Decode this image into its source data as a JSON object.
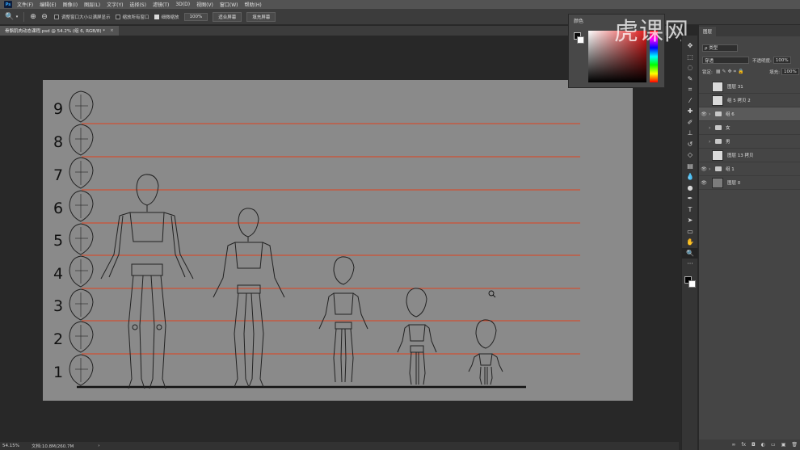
{
  "app": {
    "logo": "Ps"
  },
  "menu": [
    "文件(F)",
    "编辑(E)",
    "图像(I)",
    "图层(L)",
    "文字(Y)",
    "选择(S)",
    "滤镜(T)",
    "3D(D)",
    "视图(V)",
    "窗口(W)",
    "帮助(H)"
  ],
  "options": {
    "resize_windows": "调整窗口大小以满屏显示",
    "zoom_all": "缩放所有窗口",
    "scrubby_zoom": "细微缩放",
    "zoom_value": "100%",
    "fit_screen": "适合屏幕",
    "fill_screen": "填充屏幕"
  },
  "document": {
    "tab_title": "骨骼肌肉动态课程.psd @ 54.2% (组 6, RGB/8) *",
    "close": "×"
  },
  "status": {
    "zoom": "54.15%",
    "doc_size": "文档:10.8M/260.7M"
  },
  "color_panel": {
    "title": "颜色"
  },
  "watermark": "虎课网",
  "layers_panel": {
    "tab": "图层",
    "kind": "ρ 类型",
    "blend_mode": "穿透",
    "opacity_label": "不透明度:",
    "opacity": "100%",
    "lock_label": "锁定:",
    "fill_label": "填充:",
    "fill": "100%",
    "layers": [
      {
        "name": "图层 31",
        "type": "layer",
        "visible": false
      },
      {
        "name": "组 5 拷贝 2",
        "type": "layer",
        "visible": false
      },
      {
        "name": "组 6",
        "type": "group",
        "visible": true,
        "selected": true
      },
      {
        "name": "女",
        "type": "group",
        "visible": false
      },
      {
        "name": "男",
        "type": "group",
        "visible": false
      },
      {
        "name": "图层 13 拷贝",
        "type": "layer",
        "visible": false
      },
      {
        "name": "组 1",
        "type": "group",
        "visible": true
      },
      {
        "name": "图层 0",
        "type": "layer-grey",
        "visible": true
      }
    ],
    "footer_icons": [
      "fx",
      "◘",
      "◐",
      "▭",
      "▣",
      "🗑"
    ]
  },
  "canvas": {
    "scale_numbers": [
      "9",
      "8",
      "7",
      "6",
      "5",
      "4",
      "3",
      "2",
      "1"
    ],
    "line_color": "#e0421f",
    "background": "#8a8a8a"
  }
}
